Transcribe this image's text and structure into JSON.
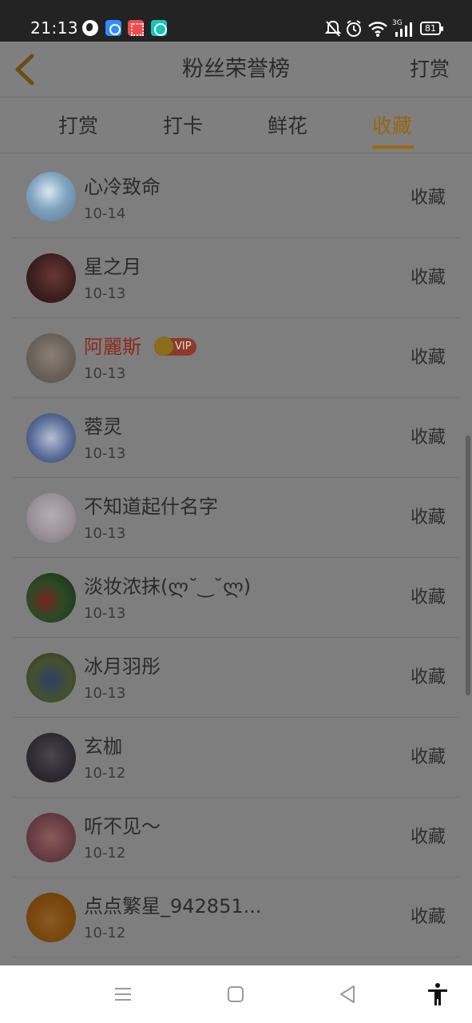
{
  "status_bar": {
    "time": "21:13",
    "battery": "81",
    "network": "3G",
    "icons": [
      "globe-app-icon",
      "blue-app-icon",
      "red-app-icon",
      "teal-app-icon",
      "mute-bell-icon",
      "alarm-icon",
      "wifi-icon",
      "signal-icon",
      "battery-icon"
    ]
  },
  "header": {
    "title": "粉丝荣誉榜",
    "action": "打赏",
    "back_icon": "chevron-left-icon"
  },
  "tabs": [
    {
      "label": "打赏",
      "active": false
    },
    {
      "label": "打卡",
      "active": false
    },
    {
      "label": "鲜花",
      "active": false
    },
    {
      "label": "收藏",
      "active": true
    }
  ],
  "accent_color": "#a06a10",
  "list": [
    {
      "name": "心冷致命",
      "date": "10-14",
      "action": "收藏",
      "vip": false
    },
    {
      "name": "星之月",
      "date": "10-13",
      "action": "收藏",
      "vip": false
    },
    {
      "name": "阿麗斯",
      "date": "10-13",
      "action": "收藏",
      "vip": true,
      "badge": "VIP"
    },
    {
      "name": "蓉灵",
      "date": "10-13",
      "action": "收藏",
      "vip": false
    },
    {
      "name": "不知道起什名字",
      "date": "10-13",
      "action": "收藏",
      "vip": false
    },
    {
      "name": "淡妆浓抹(ლ˘‿˘ლ)",
      "date": "10-13",
      "action": "收藏",
      "vip": false
    },
    {
      "name": "冰月羽彤",
      "date": "10-13",
      "action": "收藏",
      "vip": false
    },
    {
      "name": "玄枷",
      "date": "10-12",
      "action": "收藏",
      "vip": false
    },
    {
      "name": "听不见～",
      "date": "10-12",
      "action": "收藏",
      "vip": false
    },
    {
      "name": "点点繁星_942851...",
      "date": "10-12",
      "action": "收藏",
      "vip": false
    }
  ],
  "nav_bar": {
    "icons": [
      "menu-icon",
      "home-square-icon",
      "back-triangle-icon",
      "accessibility-icon"
    ]
  }
}
